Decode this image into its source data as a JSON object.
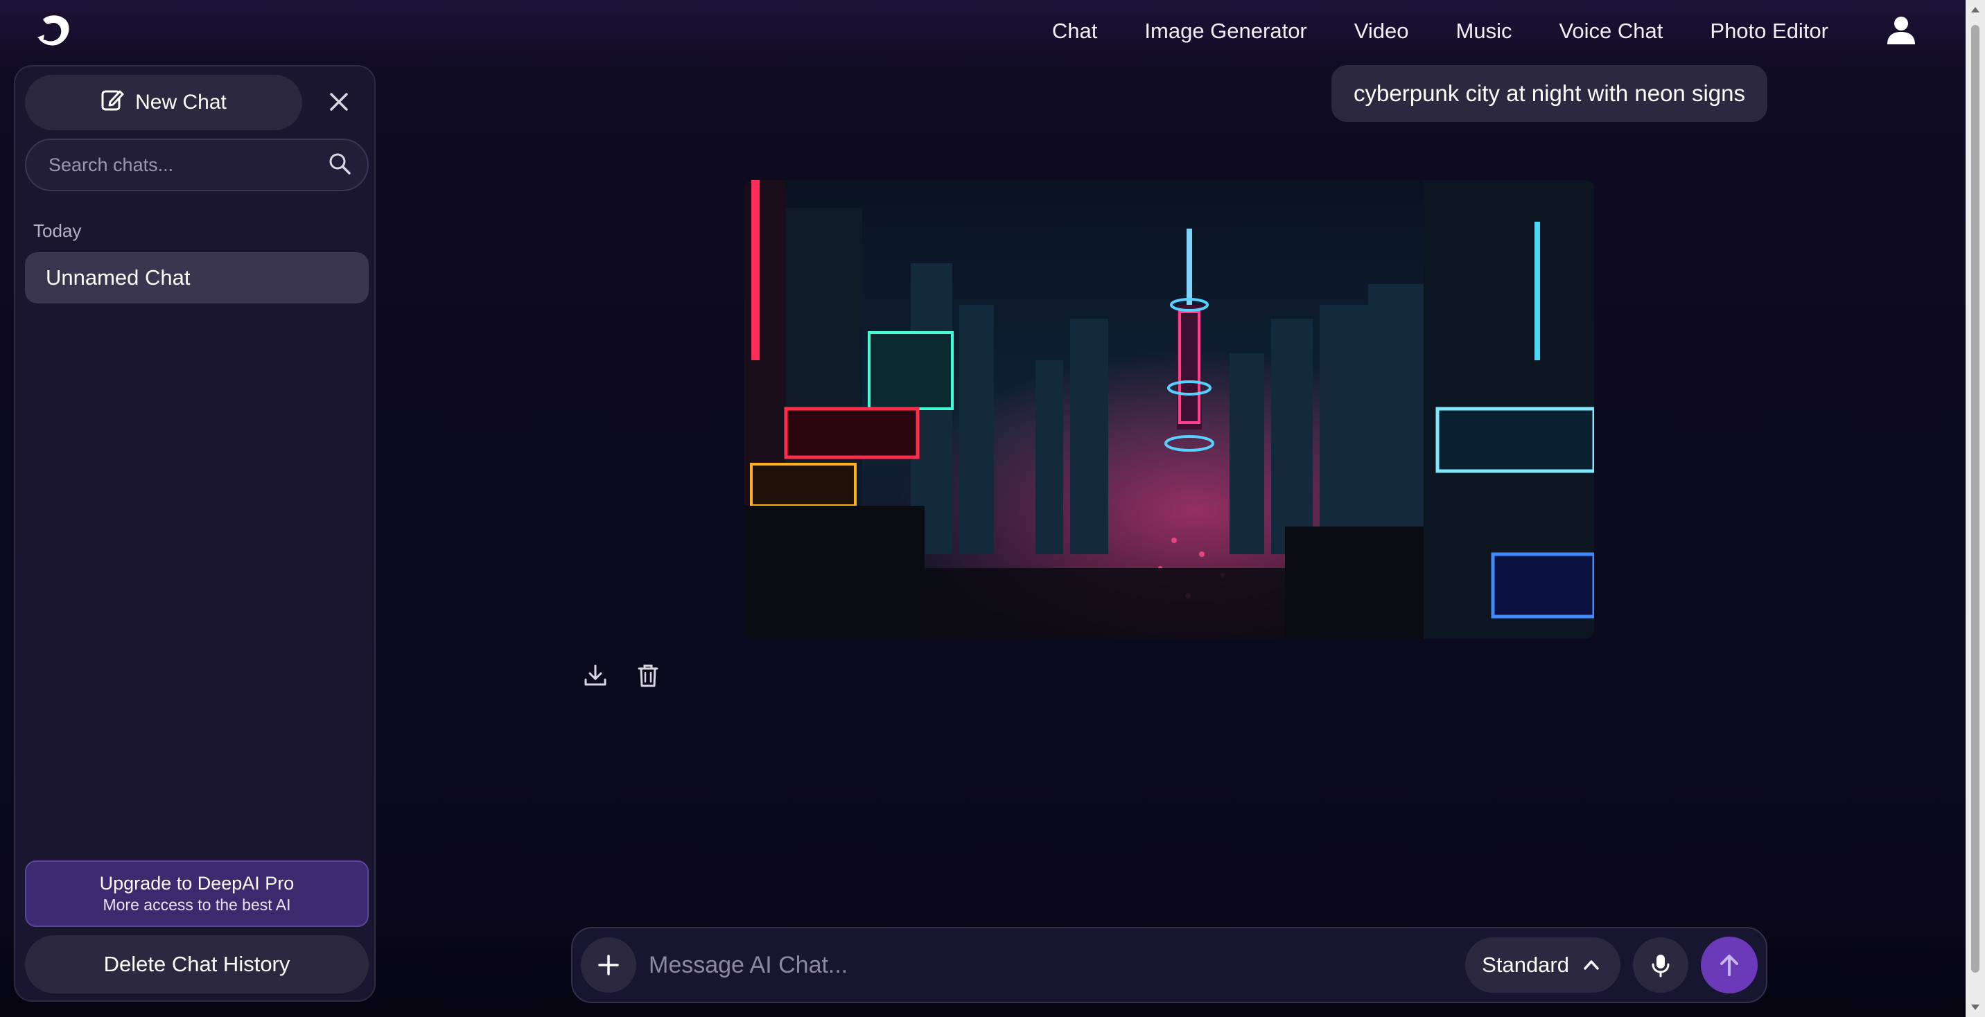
{
  "app": {
    "logo_icon": "deepai-dolphin-logo",
    "accent_color": "#6a3ab8"
  },
  "nav": {
    "items": [
      {
        "label": "Chat"
      },
      {
        "label": "Image Generator"
      },
      {
        "label": "Video"
      },
      {
        "label": "Music"
      },
      {
        "label": "Voice Chat"
      },
      {
        "label": "Photo Editor"
      }
    ],
    "user_icon": "user-icon"
  },
  "sidebar": {
    "new_chat_label": "New Chat",
    "search_placeholder": "Search chats...",
    "section_label": "Today",
    "chats": [
      {
        "title": "Unnamed Chat"
      }
    ],
    "upgrade_title": "Upgrade to DeepAI Pro",
    "upgrade_subtitle": "More access to the best AI",
    "delete_history_label": "Delete Chat History"
  },
  "conversation": {
    "user_prompt": "cyberpunk city at night with neon signs"
  },
  "composer": {
    "placeholder": "Message AI Chat...",
    "model_label": "Standard"
  }
}
